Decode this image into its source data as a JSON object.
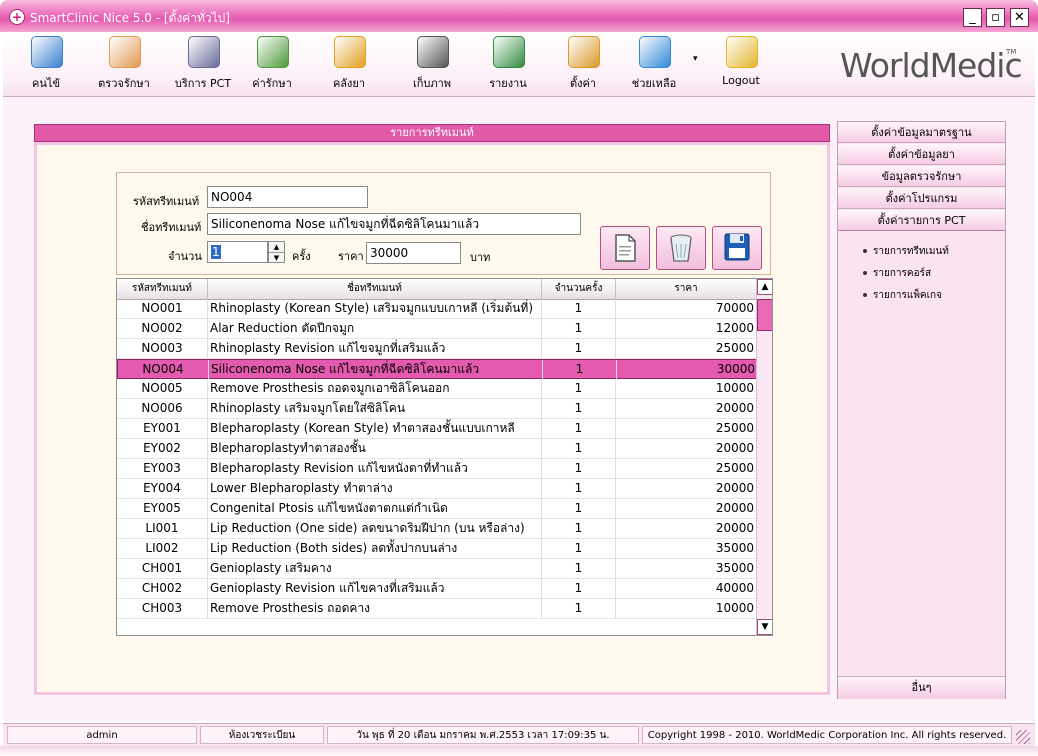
{
  "window": {
    "title": "SmartClinic Nice 5.0 - [ตั้งค่าทั่วไป]",
    "min_glyph": "_",
    "max_glyph": "▫",
    "close_glyph": "✕"
  },
  "toolbar": {
    "items": [
      {
        "label": "คนไข้",
        "icon": "patient-icon",
        "color": "#3a7fd0"
      },
      {
        "label": "ตรวจรักษา",
        "icon": "doctor-icon",
        "color": "#e29a52"
      },
      {
        "label": "บริการ PCT",
        "icon": "masks-icon",
        "color": "#6a6a9a"
      },
      {
        "label": "ค่ารักษา",
        "icon": "money-icon",
        "color": "#4c9a3a"
      },
      {
        "label": "คลังยา",
        "icon": "pill-icon",
        "color": "#e0a020"
      },
      {
        "label": "เก็บภาพ",
        "icon": "camera-icon",
        "color": "#555555"
      },
      {
        "label": "รายงาน",
        "icon": "chart-icon",
        "color": "#2f8a3e"
      },
      {
        "label": "ตั้งค่า",
        "icon": "tools-icon",
        "color": "#d99a2a"
      },
      {
        "label": "ช่วยเหลือ",
        "icon": "help-icon",
        "color": "#2f88d8"
      },
      {
        "label": "Logout",
        "icon": "lock-icon",
        "color": "#e3b62a"
      }
    ],
    "dropdown_glyph": "▾",
    "logo": "WorldMedic",
    "logo_tm": "TM"
  },
  "panel": {
    "title": "รายการทรีทเมนท์"
  },
  "form": {
    "code_label": "รหัสทรีทเมนท์",
    "code_value": "NO004",
    "name_label": "ชื่อทรีทเมนท์",
    "name_value": "Siliconenoma Nose แก้ไขจมูกที่ฉีดซิลิโคนมาแล้ว",
    "qty_label": "จำนวน",
    "qty_value": "1",
    "qty_unit": "ครั้ง",
    "price_label": "ราคา",
    "price_value": "30000",
    "price_unit": "บาท"
  },
  "actions": {
    "new_icon": "new-document-icon",
    "delete_icon": "recycle-bin-icon",
    "save_icon": "floppy-disk-icon"
  },
  "table": {
    "headers": [
      "รหัสทรีทเมนท์",
      "ชื่อทรีทเมนท์",
      "จำนวนครั้ง",
      "ราคา"
    ],
    "selected_index": 3,
    "rows": [
      {
        "code": "NO001",
        "name": "Rhinoplasty (Korean Style) เสริมจมูกแบบเกาหลี (เริ่มต้นที่)",
        "qty": "1",
        "price": "70000"
      },
      {
        "code": "NO002",
        "name": "Alar Reduction ตัดปีกจมูก",
        "qty": "1",
        "price": "12000"
      },
      {
        "code": "NO003",
        "name": "Rhinoplasty Revision แก้ไขจมูกที่เสริมแล้ว",
        "qty": "1",
        "price": "25000"
      },
      {
        "code": "NO004",
        "name": "Siliconenoma Nose แก้ไขจมูกที่ฉีดซิลิโคนมาแล้ว",
        "qty": "1",
        "price": "30000"
      },
      {
        "code": "NO005",
        "name": "Remove Prosthesis ถอดจมูกเอาซิลิโคนออก",
        "qty": "1",
        "price": "10000"
      },
      {
        "code": "NO006",
        "name": "Rhinoplasty เสริมจมูกโดยใส่ซิลิโคน",
        "qty": "1",
        "price": "20000"
      },
      {
        "code": "EY001",
        "name": "Blepharoplasty (Korean Style) ทำตาสองชั้นแบบเกาหลี",
        "qty": "1",
        "price": "25000"
      },
      {
        "code": "EY002",
        "name": "Blepharoplastyทำตาสองชั้น",
        "qty": "1",
        "price": "20000"
      },
      {
        "code": "EY003",
        "name": "Blepharoplasty Revision แก้ไขหนังตาที่ทำแล้ว",
        "qty": "1",
        "price": "25000"
      },
      {
        "code": "EY004",
        "name": "Lower Blepharoplasty ทำตาล่าง",
        "qty": "1",
        "price": "20000"
      },
      {
        "code": "EY005",
        "name": "Congenital Ptosis แก้ไขหนังตาตกแต่กำเนิด",
        "qty": "1",
        "price": "20000"
      },
      {
        "code": "LI001",
        "name": "Lip Reduction (One side) ลดขนาดริมฝีปาก (บน หรือล่าง)",
        "qty": "1",
        "price": "20000"
      },
      {
        "code": "LI002",
        "name": "Lip Reduction (Both sides) ลดทั้งปากบนล่าง",
        "qty": "1",
        "price": "35000"
      },
      {
        "code": "CH001",
        "name": "Genioplasty เสริมคาง",
        "qty": "1",
        "price": "35000"
      },
      {
        "code": "CH002",
        "name": "Genioplasty Revision แก้ไขคางที่เสริมแล้ว",
        "qty": "1",
        "price": "40000"
      },
      {
        "code": "CH003",
        "name": "Remove Prosthesis ถอดคาง",
        "qty": "1",
        "price": "10000"
      }
    ],
    "scroll_up_glyph": "▲",
    "scroll_down_glyph": "▼"
  },
  "sidebar": {
    "buttons": [
      "ตั้งค่าข้อมูลมาตรฐาน",
      "ตั้งค่าข้อมูลยา",
      "ข้อมูลตรวจรักษา",
      "ตั้งค่าโปรแกรม",
      "ตั้งค่ารายการ PCT"
    ],
    "links": [
      "รายการทรีทเมนท์",
      "รายการคอร์ส",
      "รายการแพ็คเกจ"
    ],
    "bottom_button": "อื่นๆ"
  },
  "status": {
    "user": "admin",
    "room": "ห้องเวชระเบียน",
    "datetime": "วัน พุธ ที่ 20 เดือน มกราคม พ.ศ.2553 เวลา 17:09:35 น.",
    "copyright": "Copyright 1998 - 2010. WorldMedic Corporation Inc. All rights reserved."
  }
}
